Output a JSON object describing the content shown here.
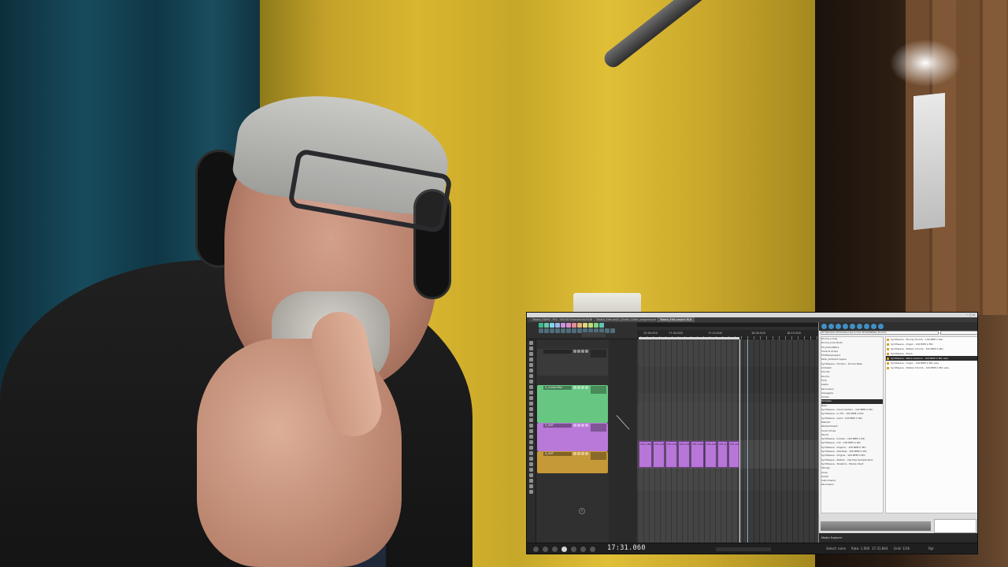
{
  "window": {
    "title": "",
    "tabs": [
      {
        "label": "Tatata_EDHS - PTL - MOOD Trancelntro.RLRPP",
        "active": false
      },
      {
        "label": "Tatata_Edit sfd21_Drafts_Glitte_progressive.RLRPP",
        "active": false
      },
      {
        "label": "Tatata_Edit project.RLR",
        "active": true
      }
    ]
  },
  "toolbar": {
    "colors": [
      "#3fb88a",
      "#6dc7a8",
      "#7ed7f0",
      "#a3b6e8",
      "#c497e0",
      "#dd8ecb",
      "#e08e9c",
      "#e2b37b",
      "#e3d57e",
      "#b9db7b",
      "#86d17d",
      "#5fc6b6"
    ]
  },
  "tracks": [
    {
      "name": "",
      "color": "#3a3a3a"
    },
    {
      "name": "2_Guitar/Mix",
      "color": "#67c682"
    },
    {
      "name": "3_SNT",
      "color": "#b879d8"
    },
    {
      "name": "4_SNT",
      "color": "#c59838"
    }
  ],
  "ruler": {
    "labels": [
      "15.00.000",
      "17.00.000",
      "17.15.000",
      "18.00.000",
      "18.15.000"
    ]
  },
  "items": {
    "label": "CHL-A-Bb"
  },
  "media_explorer": {
    "path": "D:\\Sample Libraries\\Loops & One Shots\\Tatata_Drums\\",
    "tree": [
      {
        "label": "Drums_Loops",
        "selected": false
      },
      {
        "label": "Drums_One Shots",
        "selected": false
      },
      {
        "label": "FX_Downlifters",
        "selected": false
      },
      {
        "label": "Vocal & Drops",
        "selected": false
      },
      {
        "label": "FX/Fillers/Lasers",
        "selected": false
      },
      {
        "label": "Pads_Ambient Layers",
        "selected": false
      },
      {
        "label": "Synthwave - Horizon - Drums Bass",
        "selected": false
      },
      {
        "label": "Ambiant",
        "selected": false
      },
      {
        "label": "Chords",
        "selected": false
      },
      {
        "label": "Drums",
        "selected": false
      },
      {
        "label": "FX/X",
        "selected": false
      },
      {
        "label": "Leads",
        "selected": false
      },
      {
        "label": "Percussion",
        "selected": false
      },
      {
        "label": "Arpeggios",
        "selected": false
      },
      {
        "label": "Vocals",
        "selected": false
      },
      {
        "label": "Samples",
        "selected": true
      },
      {
        "label": "Bass",
        "selected": false
      },
      {
        "label": "Synthwave - Cloud Guitars - 100 BPM A Min",
        "selected": false
      },
      {
        "label": "Synthwave - Lv Hit - 100 BPM A Min",
        "selected": false
      },
      {
        "label": "Synthwave - Lead - 100 BPM C Min",
        "selected": false
      },
      {
        "label": "Melodic",
        "selected": false
      },
      {
        "label": "Pads/Ambient",
        "selected": false
      },
      {
        "label": "Vocal Chops",
        "selected": false
      },
      {
        "label": "World",
        "selected": false
      },
      {
        "label": "Synthwave - Arcade - 100 BPM A Min",
        "selected": false
      },
      {
        "label": "Synthwave - Cut - 100 BPM A Min",
        "selected": false
      },
      {
        "label": "Synthwave - Organic - 120 BPM D Min",
        "selected": false
      },
      {
        "label": "Synthwave - Starfade - 100 BPM A Min",
        "selected": false
      },
      {
        "label": "Synthwave - Origins - 100 BPM D Min",
        "selected": false
      },
      {
        "label": "Synthwave - Station - Hip-Hop Sample Pack",
        "selected": false
      },
      {
        "label": "Synthwave - Tenebris - Moody Vault",
        "selected": false
      },
      {
        "label": "Strings",
        "selected": false
      },
      {
        "label": "Lines",
        "selected": false
      },
      {
        "label": "Guitar",
        "selected": false
      },
      {
        "label": "Instruments",
        "selected": false
      },
      {
        "label": "Percussion",
        "selected": false
      }
    ],
    "files": [
      {
        "label": "Synthwave - Moody Chords - 100 BPM A Min",
        "selected": false
      },
      {
        "label": "Synthwave - Organ - 100 BPM A Min",
        "selected": false
      },
      {
        "label": "Synthwave - Station Chords - 100 BPM A Min",
        "selected": false
      },
      {
        "label": "Synthwave - Piano",
        "selected": false
      },
      {
        "label": "Synthwave - Wave Lessons - 100 BPM C Min wav",
        "selected": true
      },
      {
        "label": "Synthwave - Organ - 100 BPM A Min.wav",
        "selected": false
      },
      {
        "label": "Synthwave - Station Chords - 100 BPM A Min wav",
        "selected": false
      }
    ],
    "tab_label": "Media Explorer"
  },
  "transport": {
    "time": "17:31.060",
    "info": [
      "Select: none",
      "Rate: 1.000",
      "17.31.844",
      "Grid: 1/16",
      "Rpl"
    ]
  }
}
